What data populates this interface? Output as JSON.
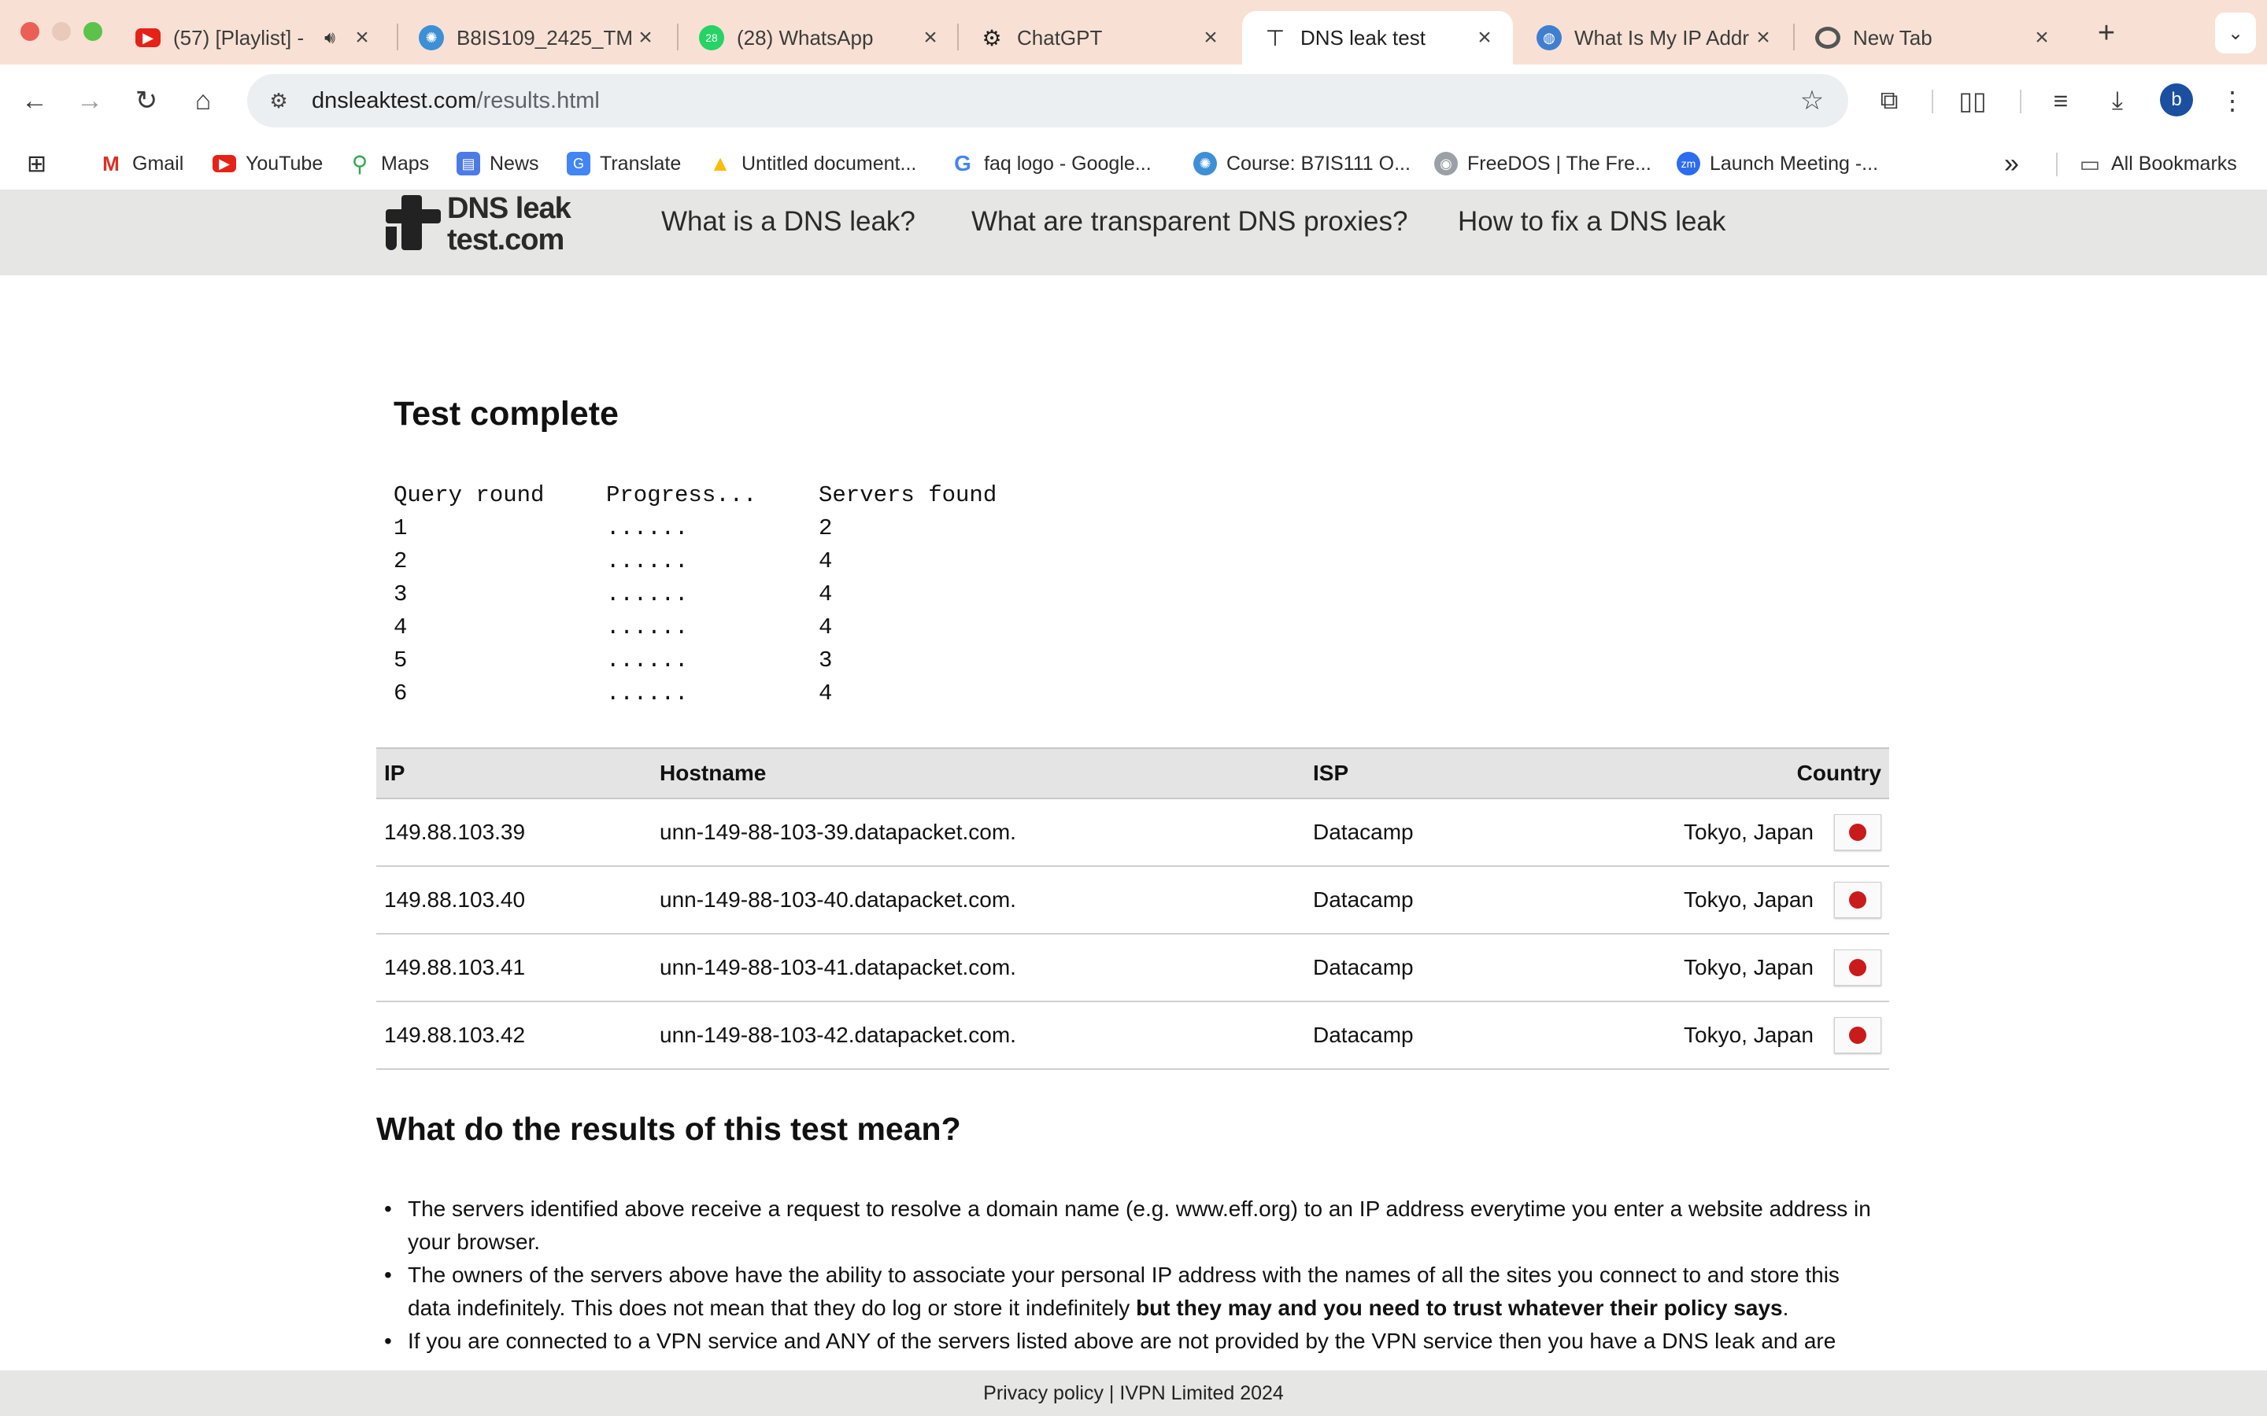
{
  "browser": {
    "tabs": [
      {
        "title": "(57) [Playlist] -",
        "favicon": "youtube-icon",
        "sound": true
      },
      {
        "title": "B8IS109_2425_TM",
        "favicon": "moodle-icon"
      },
      {
        "title": "(28) WhatsApp",
        "favicon": "whatsapp-icon",
        "badge": "28"
      },
      {
        "title": "ChatGPT",
        "favicon": "chatgpt-icon"
      },
      {
        "title": "DNS leak test",
        "favicon": "dns-tap-icon",
        "active": true
      },
      {
        "title": "What Is My IP Addr",
        "favicon": "globe-icon"
      },
      {
        "title": "New Tab",
        "favicon": "chrome-icon"
      }
    ],
    "address": {
      "host": "dnsleaktest.com",
      "path": "/results.html"
    },
    "profile_initial": "b",
    "bookmarks": [
      {
        "label": "Gmail",
        "icon": "gmail-icon"
      },
      {
        "label": "YouTube",
        "icon": "youtube-icon"
      },
      {
        "label": "Maps",
        "icon": "maps-icon"
      },
      {
        "label": "News",
        "icon": "news-icon"
      },
      {
        "label": "Translate",
        "icon": "translate-icon"
      },
      {
        "label": "Untitled document...",
        "icon": "drive-icon"
      },
      {
        "label": "faq logo - Google...",
        "icon": "google-icon"
      },
      {
        "label": "Course: B7IS111 O...",
        "icon": "moodle-icon"
      },
      {
        "label": "FreeDOS | The Fre...",
        "icon": "freedos-icon"
      },
      {
        "label": "Launch Meeting -...",
        "icon": "zoom-icon"
      }
    ],
    "all_bookmarks": "All Bookmarks"
  },
  "site": {
    "logo_line1": "DNS leak",
    "logo_line2": "test.com",
    "nav": [
      "What is a DNS leak?",
      "What are transparent DNS proxies?",
      "How to fix a DNS leak"
    ]
  },
  "test": {
    "title": "Test complete",
    "headers": [
      "Query round",
      "Progress...",
      "Servers found"
    ],
    "rounds": [
      {
        "round": "1",
        "progress": "......",
        "found": "2"
      },
      {
        "round": "2",
        "progress": "......",
        "found": "4"
      },
      {
        "round": "3",
        "progress": "......",
        "found": "4"
      },
      {
        "round": "4",
        "progress": "......",
        "found": "4"
      },
      {
        "round": "5",
        "progress": "......",
        "found": "3"
      },
      {
        "round": "6",
        "progress": "......",
        "found": "4"
      }
    ]
  },
  "results": {
    "headers": {
      "ip": "IP",
      "hostname": "Hostname",
      "isp": "ISP",
      "country": "Country"
    },
    "rows": [
      {
        "ip": "149.88.103.39",
        "hostname": "unn-149-88-103-39.datapacket.com.",
        "isp": "Datacamp",
        "country": "Tokyo, Japan"
      },
      {
        "ip": "149.88.103.40",
        "hostname": "unn-149-88-103-40.datapacket.com.",
        "isp": "Datacamp",
        "country": "Tokyo, Japan"
      },
      {
        "ip": "149.88.103.41",
        "hostname": "unn-149-88-103-41.datapacket.com.",
        "isp": "Datacamp",
        "country": "Tokyo, Japan"
      },
      {
        "ip": "149.88.103.42",
        "hostname": "unn-149-88-103-42.datapacket.com.",
        "isp": "Datacamp",
        "country": "Tokyo, Japan"
      }
    ]
  },
  "meaning": {
    "title": "What do the results of this test mean?",
    "bullet1": "The servers identified above receive a request to resolve a domain name (e.g. www.eff.org) to an IP address everytime you enter a website address in your browser.",
    "bullet2_a": "The owners of the servers above have the ability to associate your personal IP address with the names of all the sites you connect to and store this data indefinitely. This does not mean that they do log or store it indefinitely ",
    "bullet2_b": "but they may and you need to trust whatever their policy says",
    "bullet2_c": ".",
    "bullet3": "If you are connected to a VPN service and ANY of the servers listed above are not provided by the VPN service then you have a DNS leak and are"
  },
  "footer": {
    "privacy": "Privacy policy",
    "separator": " | ",
    "company": "IVPN Limited 2024"
  },
  "colors": {
    "tabstrip": "#f8e1d4",
    "site_header": "#e6e6e4",
    "flag_red": "#c91b1b"
  }
}
